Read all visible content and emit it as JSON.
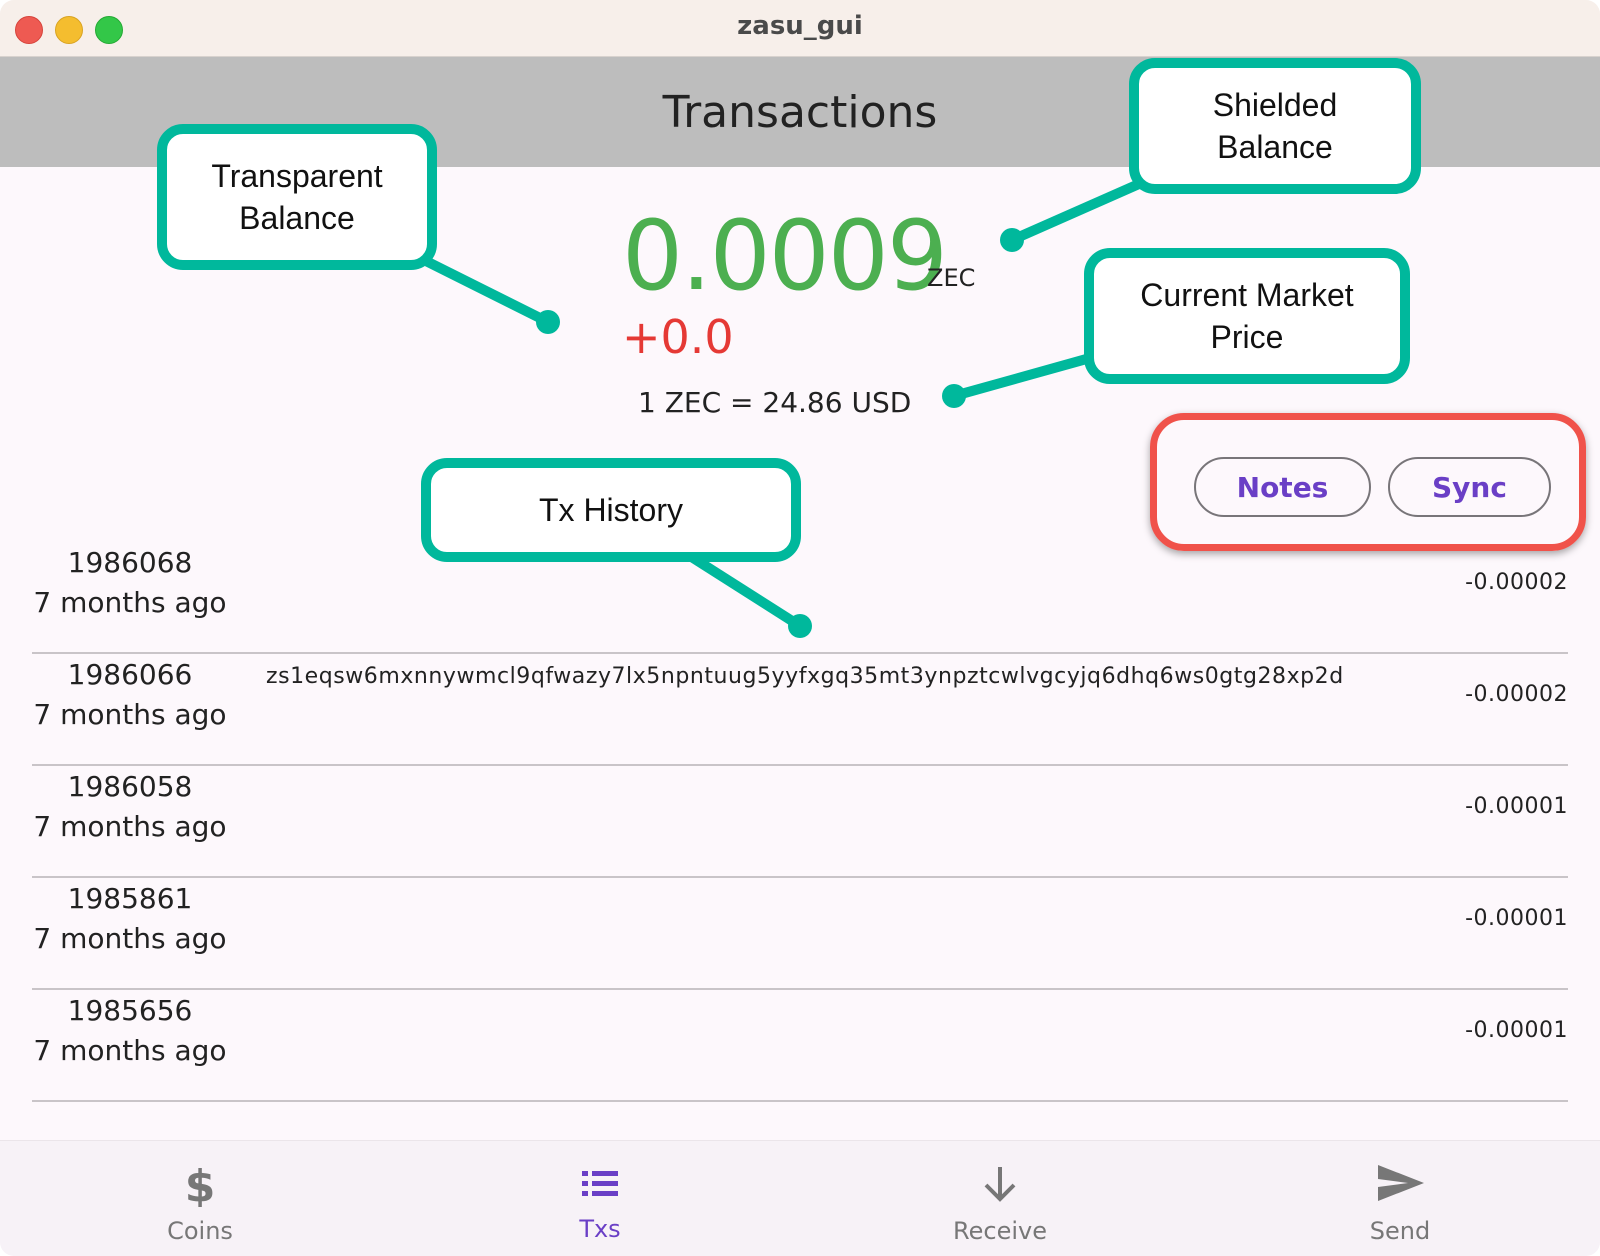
{
  "window": {
    "title": "zasu_gui"
  },
  "appbar": {
    "title": "Transactions"
  },
  "balance": {
    "shielded": "0.0009",
    "unit": "ZEC",
    "transparent": "+0.0",
    "rate": "1 ZEC = 24.86 USD"
  },
  "actions": {
    "notes_label": "Notes",
    "sync_label": "Sync"
  },
  "transactions": [
    {
      "height": "1986068",
      "ago": "7 months ago",
      "address": "",
      "amount": "-0.00002"
    },
    {
      "height": "1986066",
      "ago": "7 months ago",
      "address": "zs1eqsw6mxnnywmcl9qfwazy7lx5npntuug5yyfxgq35mt3ynpztcwlvgcyjq6dhq6ws0gtg28xp2d",
      "amount": "-0.00002"
    },
    {
      "height": "1986058",
      "ago": "7 months ago",
      "address": "",
      "amount": "-0.00001"
    },
    {
      "height": "1985861",
      "ago": "7 months ago",
      "address": "",
      "amount": "-0.00001"
    },
    {
      "height": "1985656",
      "ago": "7 months ago",
      "address": "",
      "amount": "-0.00001"
    }
  ],
  "nav": {
    "items": [
      {
        "label": "Coins",
        "icon": "dollar-icon"
      },
      {
        "label": "Txs",
        "icon": "list-icon",
        "active": true
      },
      {
        "label": "Receive",
        "icon": "arrow-down-icon"
      },
      {
        "label": "Send",
        "icon": "send-icon"
      }
    ]
  },
  "callouts": {
    "transparent": "Transparent Balance",
    "shielded": "Shielded Balance",
    "market": "Current Market Price",
    "history": "Tx History"
  },
  "colors": {
    "accent": "#6a3fc6",
    "balance_green": "#4caf50",
    "transparent_red": "#e53935",
    "callout_teal": "#00b89c",
    "highlight_red": "#f0524a"
  }
}
